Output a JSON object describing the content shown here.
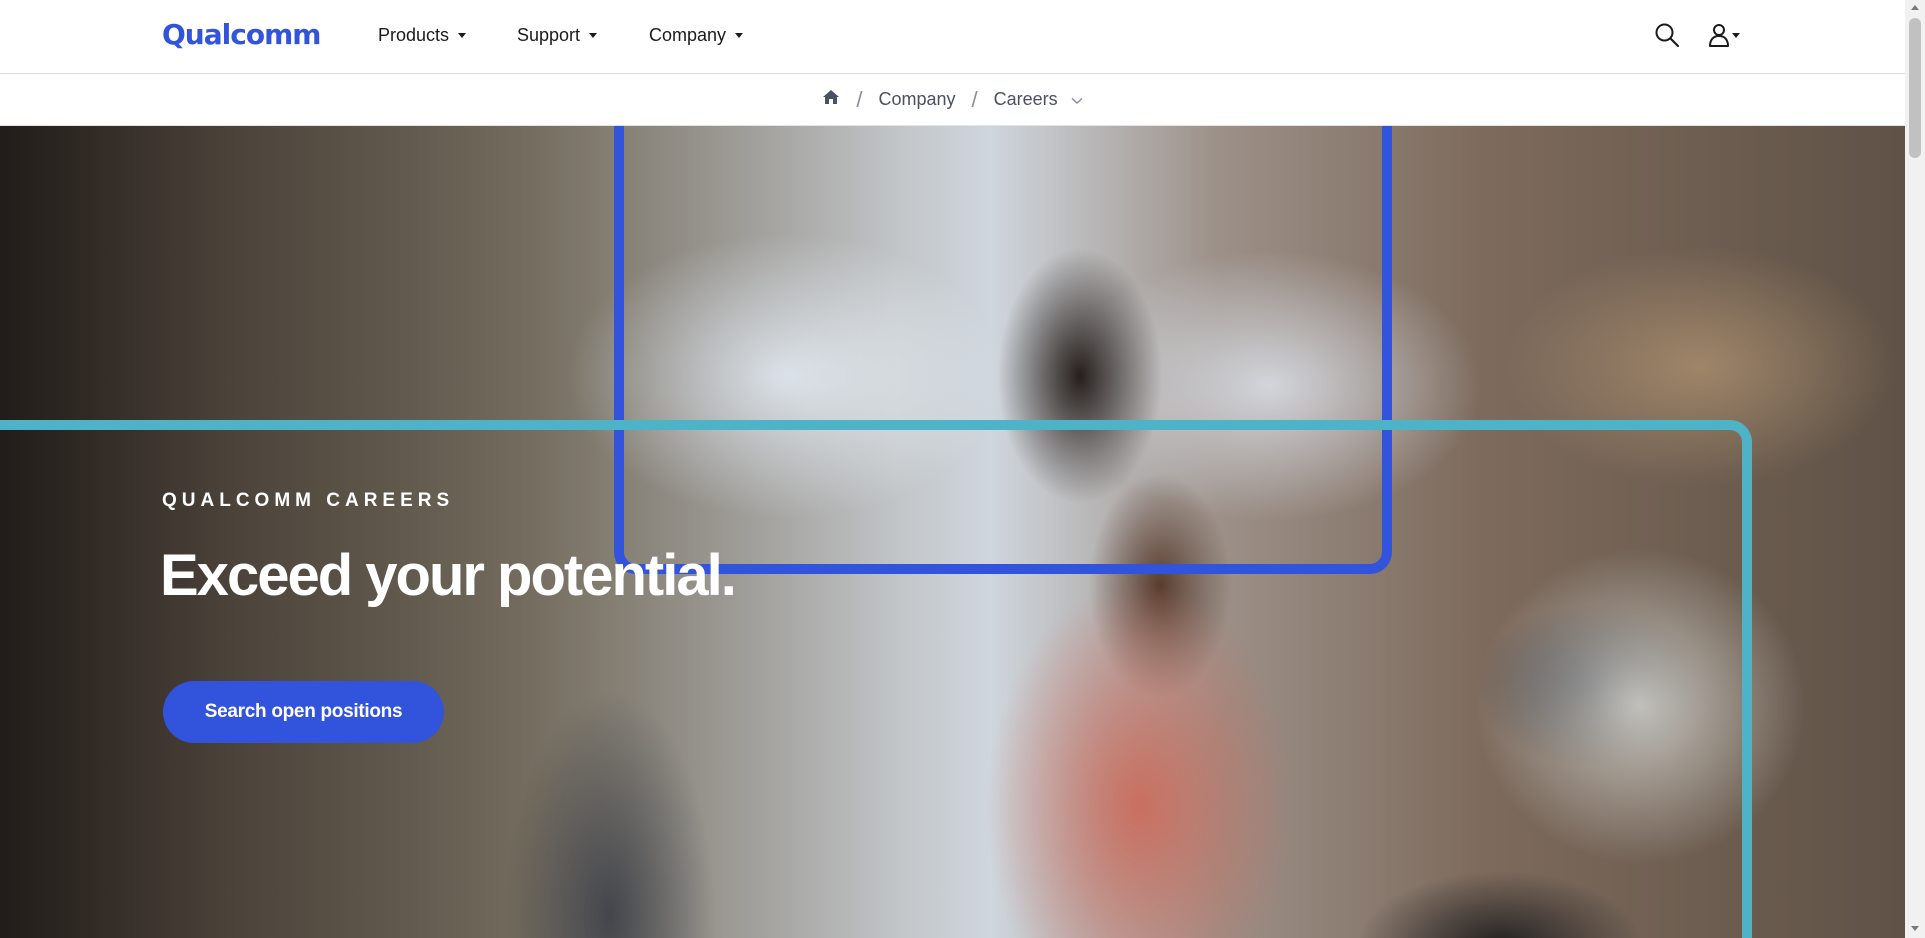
{
  "header": {
    "logo_text": "Qualcomm",
    "nav": [
      {
        "label": "Products",
        "icon": "caret-down-icon"
      },
      {
        "label": "Support",
        "icon": "caret-down-icon"
      },
      {
        "label": "Company",
        "icon": "caret-down-icon"
      }
    ],
    "search_icon": "search-icon",
    "account_icon": "user-icon"
  },
  "breadcrumb": {
    "home_icon": "home-icon",
    "separator": "/",
    "items": [
      {
        "label": "Company"
      },
      {
        "label": "Careers",
        "icon": "chevron-down-icon"
      }
    ]
  },
  "hero": {
    "eyebrow": "QUALCOMM CAREERS",
    "title": "Exceed your potential.",
    "cta_label": "Search open positions"
  },
  "colors": {
    "brand_blue": "#3253dc",
    "accent_teal": "#4fb3c7",
    "text_dark": "#1b1b1b",
    "breadcrumb_text": "#4c5063"
  }
}
